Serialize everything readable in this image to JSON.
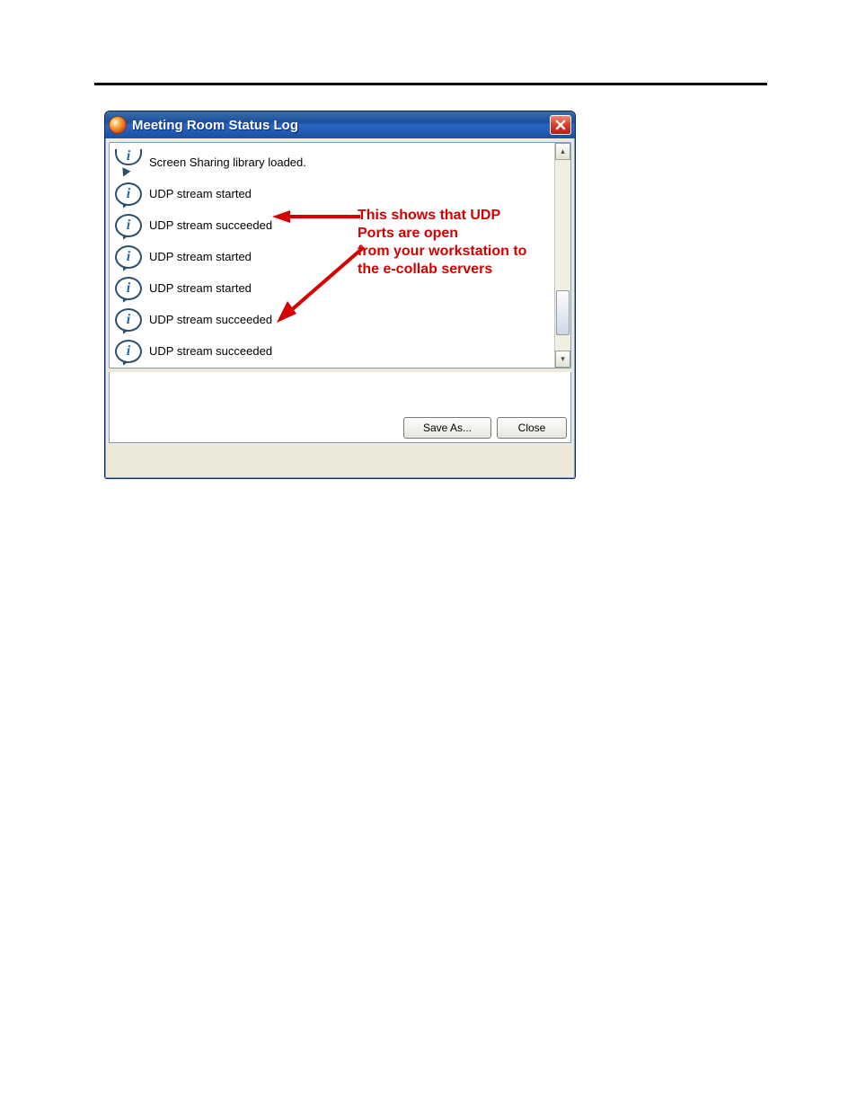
{
  "window": {
    "title": "Meeting Room Status Log",
    "save_label": "Save As...",
    "close_label": "Close"
  },
  "log": [
    {
      "text": "Screen Sharing library loaded."
    },
    {
      "text": "UDP stream started"
    },
    {
      "text": "UDP stream succeeded"
    },
    {
      "text": "UDP stream started"
    },
    {
      "text": "UDP stream started"
    },
    {
      "text": "UDP stream succeeded"
    },
    {
      "text": "UDP stream succeeded"
    }
  ],
  "annotation": {
    "line1": "This shows that UDP",
    "line2": "Ports are open",
    "line3": "from your workstation to",
    "line4": "the e-collab servers"
  },
  "link": {
    "text": ""
  }
}
